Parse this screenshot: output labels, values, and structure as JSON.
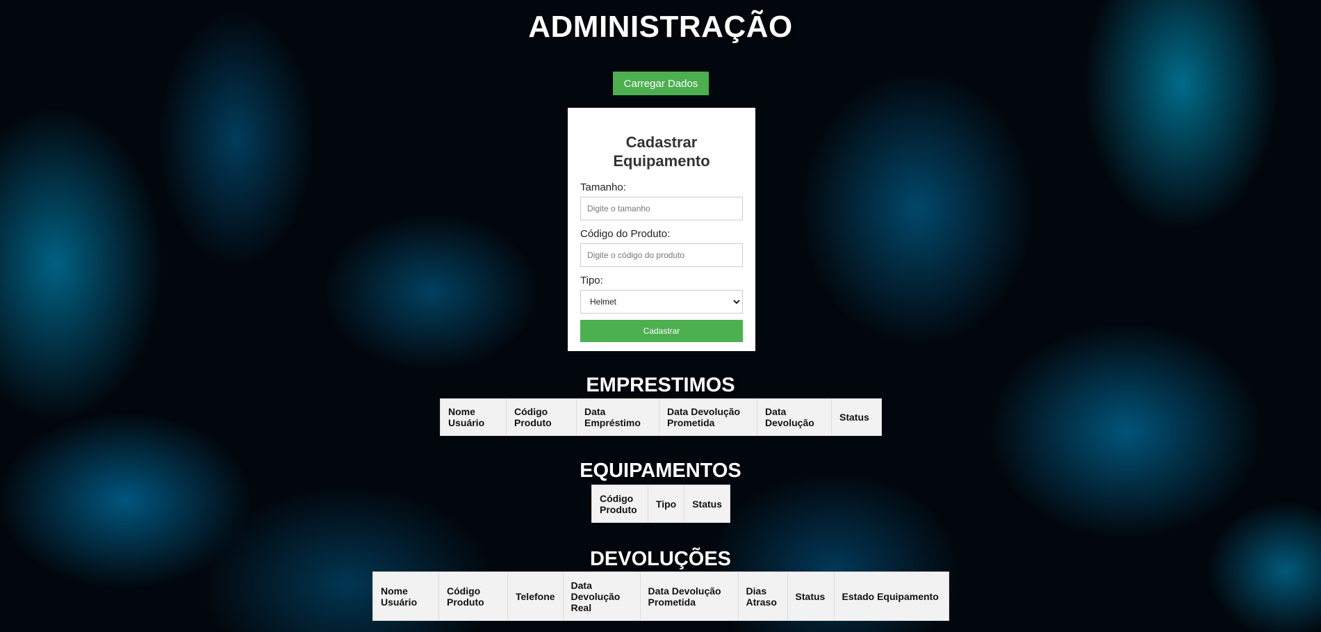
{
  "header": {
    "title": "ADMINISTRAÇÃO",
    "load_button": "Carregar Dados"
  },
  "form": {
    "title": "Cadastrar Equipamento",
    "size_label": "Tamanho:",
    "size_placeholder": "Digite o tamanho",
    "code_label": "Código do Produto:",
    "code_placeholder": "Digite o código do produto",
    "type_label": "Tipo:",
    "type_selected": "Helmet",
    "submit_label": "Cadastrar"
  },
  "loans": {
    "title": "EMPRESTIMOS",
    "columns": [
      "Nome Usuário",
      "Código Produto",
      "Data Empréstimo",
      "Data Devolução Prometida",
      "Data Devolução",
      "Status"
    ]
  },
  "equipment": {
    "title": "EQUIPAMENTOS",
    "columns": [
      "Código Produto",
      "Tipo",
      "Status"
    ]
  },
  "returns": {
    "title": "DEVOLUÇÕES",
    "columns": [
      "Nome Usuário",
      "Código Produto",
      "Telefone",
      "Data Devolução Real",
      "Data Devolução Prometida",
      "Dias Atraso",
      "Status",
      "Estado Equipamento"
    ]
  }
}
